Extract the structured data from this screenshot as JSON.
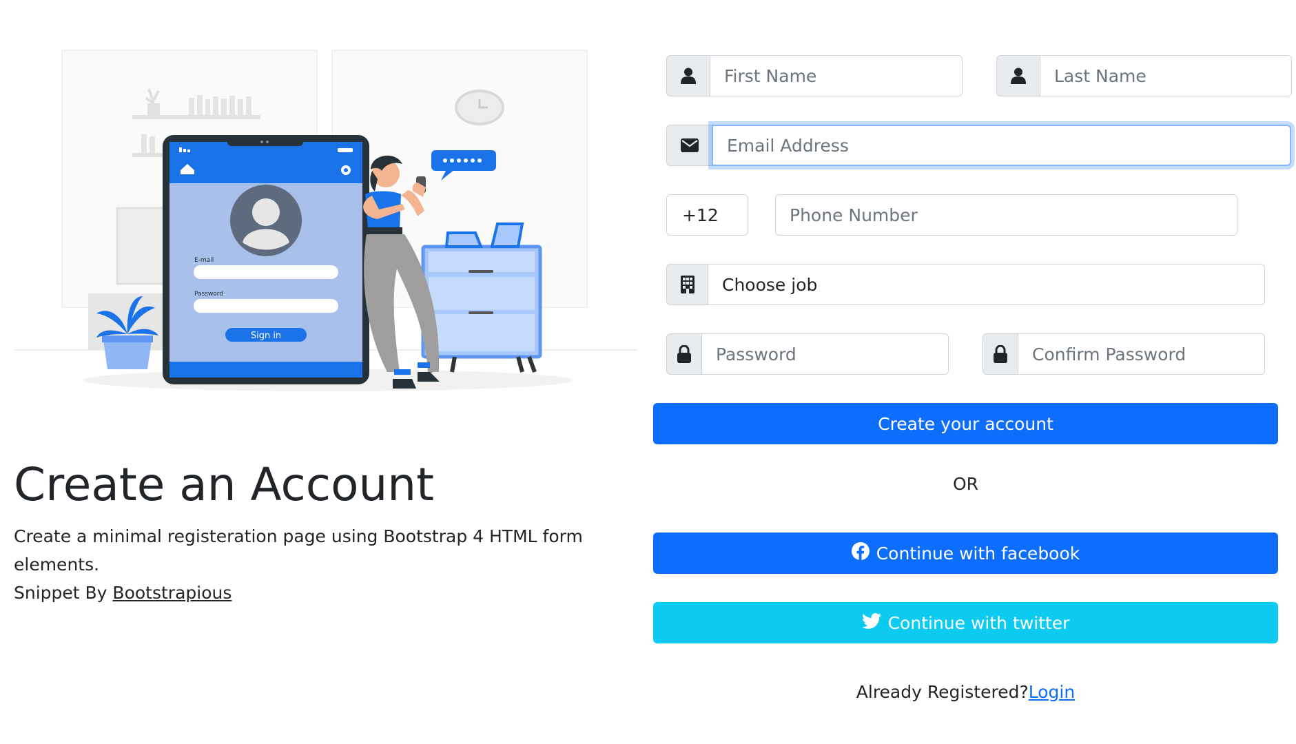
{
  "illustration": {
    "phone_email_label": "E-mail",
    "phone_password_label": "Password",
    "phone_signin_label": "Sign in"
  },
  "intro": {
    "title": "Create an Account",
    "description": "Create a minimal registeration page using Bootstrap 4 HTML form elements.",
    "credit_prefix": "Snippet By ",
    "credit_link": "Bootstrapious"
  },
  "form": {
    "first_name_placeholder": "First Name",
    "last_name_placeholder": "Last Name",
    "email_placeholder": "Email Address",
    "phone_code": "+12",
    "phone_placeholder": "Phone Number",
    "job_selected": "Choose job",
    "password_placeholder": "Password",
    "confirm_password_placeholder": "Confirm Password",
    "submit_label": "Create your account",
    "or_label": "OR",
    "facebook_label": "Continue with facebook",
    "twitter_label": "Continue with twitter",
    "already_registered": "Already Registered?",
    "login_link": "Login"
  },
  "colors": {
    "primary": "#0d6efd",
    "info": "#0dcaf0",
    "illustration_blue": "#1a73e8"
  }
}
